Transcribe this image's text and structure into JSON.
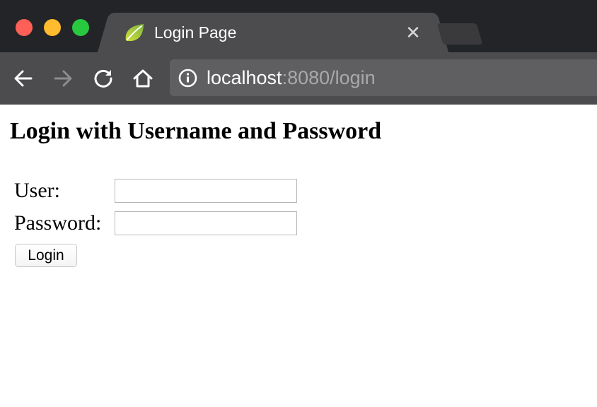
{
  "browser": {
    "tab": {
      "title": "Login Page",
      "favicon": "spring-leaf-icon",
      "close_glyph": "✕"
    },
    "address": {
      "host": "localhost",
      "rest": ":8080/login"
    },
    "icons": {
      "back": "back-arrow-icon",
      "forward": "forward-arrow-icon",
      "reload": "reload-icon",
      "home": "home-icon",
      "info": "info-icon"
    },
    "colors": {
      "titlebar": "#232427",
      "toolbar": "#4c4c4e",
      "omnibox": "#5f5f61",
      "close": "#fe5f57",
      "minimize": "#febc2e",
      "maximize": "#28c840",
      "favicon": "#8bc34a"
    }
  },
  "page": {
    "heading": "Login with Username and Password",
    "form": {
      "user_label": "User:",
      "user_value": "",
      "password_label": "Password:",
      "password_value": "",
      "submit_label": "Login"
    }
  }
}
